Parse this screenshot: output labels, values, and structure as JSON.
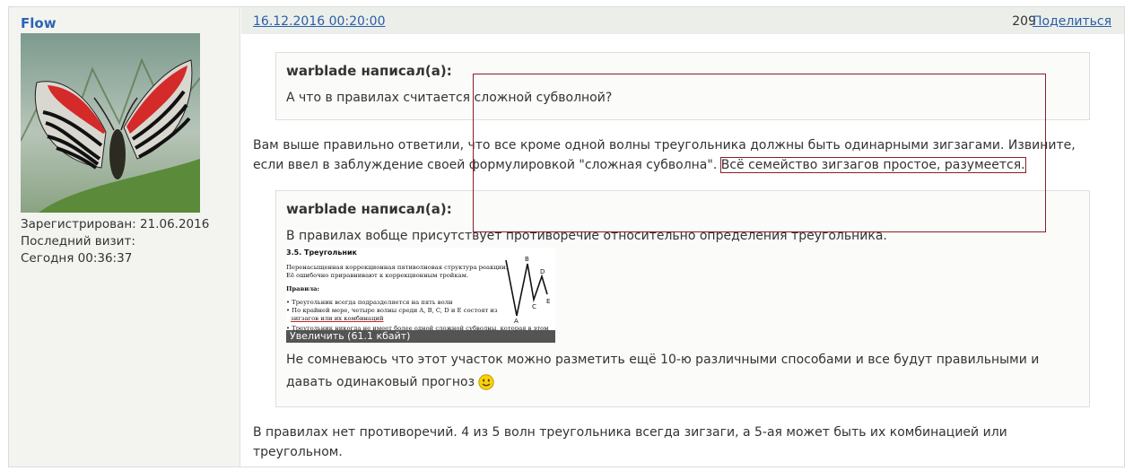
{
  "author": {
    "name": "Flow",
    "registered": "Зарегистрирован: 21.06.2016",
    "last_visit_label": "Последний визит:",
    "last_visit_value": "Сегодня 00:36:37"
  },
  "post": {
    "date": "16.12.2016 00:20:00",
    "number": "209",
    "share_label": "Поделиться"
  },
  "quote1": {
    "author": "warblade написал(а):",
    "text": "А что в правилах считается сложной субволной?"
  },
  "reply1": {
    "text_before": "Вам выше правильно ответили, что все кроме одной волны треугольника должны быть одинарными зигзагами. Извините, если ввел в заблуждение своей формулировкой \"сложная субволна\". ",
    "highlight": "Всё семейство зигзагов простое, разумеется."
  },
  "quote2": {
    "author": "warblade написал(а):",
    "text1": "В правилах вобще присутствует противоречие относительно определения треугольника.",
    "text2": "Не сомневаюсь что этот участок можно разметить ещё 10-ю различными способами и все будут правильными и давать одинаковый прогноз",
    "image": {
      "title": "3.5. Треугольник",
      "line1": "Перенасыщенная коррекционная пятиволновая структура реакции.",
      "line2": "Её ошибочно приравнивают к коррекционным тройкам.",
      "rules": "Правила:",
      "bullet1": "• Треугольник всегда подразделяется на пять волн",
      "bullet2": "• По крайней мере, четыре волны среди A, B, C, D и E состоят из",
      "bullet2b": "зигзагов или их комбинаций",
      "bullet3": "• Треугольник никогда не имеет более одной сложной субволны, которая в этом",
      "labels": [
        "A",
        "B",
        "C",
        "D",
        "E"
      ],
      "enlarge": "Увеличить (61.1 кбайт)"
    }
  },
  "reply2": {
    "text": "В правилах нет противоречий. 4 из 5 волн треугольника всегда зигзаги, а 5-ая может быть их комбинацией или треугольном."
  },
  "colors": {
    "link": "#2b5ea8",
    "author_name": "#2b64b5",
    "highlight_border": "#8a1f2a",
    "sidebar_bg": "#f3f4f0"
  },
  "icons": [
    "butterfly-avatar",
    "smiley-icon"
  ]
}
